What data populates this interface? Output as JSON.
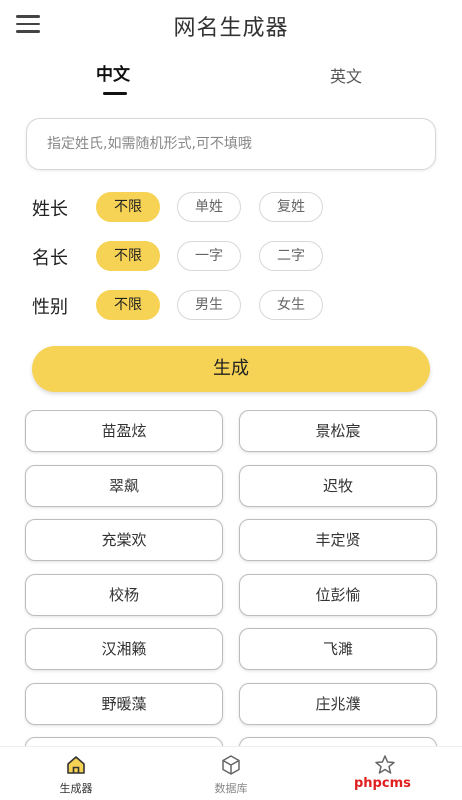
{
  "header": {
    "title": "网名生成器",
    "menu_icon": "hamburger-menu-icon"
  },
  "tabs": [
    {
      "label": "中文",
      "active": true
    },
    {
      "label": "英文",
      "active": false
    }
  ],
  "search": {
    "placeholder": "指定姓氏,如需随机形式,可不填哦",
    "value": ""
  },
  "options": [
    {
      "label": "姓长",
      "choices": [
        "不限",
        "单姓",
        "复姓"
      ],
      "selected": "不限"
    },
    {
      "label": "名长",
      "choices": [
        "不限",
        "一字",
        "二字"
      ],
      "selected": "不限"
    },
    {
      "label": "性别",
      "choices": [
        "不限",
        "男生",
        "女生"
      ],
      "selected": "不限"
    }
  ],
  "generate_label": "生成",
  "results": [
    [
      "苗盈炫",
      "景松宸"
    ],
    [
      "翠飙",
      "迟牧"
    ],
    [
      "充棠欢",
      "丰定贤"
    ],
    [
      "校杨",
      "位彭愉"
    ],
    [
      "汉湘籁",
      "飞濉"
    ],
    [
      "野暖藻",
      "庄兆濮"
    ]
  ],
  "bottom_nav": [
    {
      "label": "生成器",
      "icon": "home-icon",
      "active": true
    },
    {
      "label": "数据库",
      "icon": "box-icon",
      "active": false
    },
    {
      "label": "",
      "icon": "star-icon",
      "active": false
    }
  ],
  "watermark": "phpcms",
  "colors": {
    "accent": "#f6d354",
    "watermark": "#e02020"
  }
}
